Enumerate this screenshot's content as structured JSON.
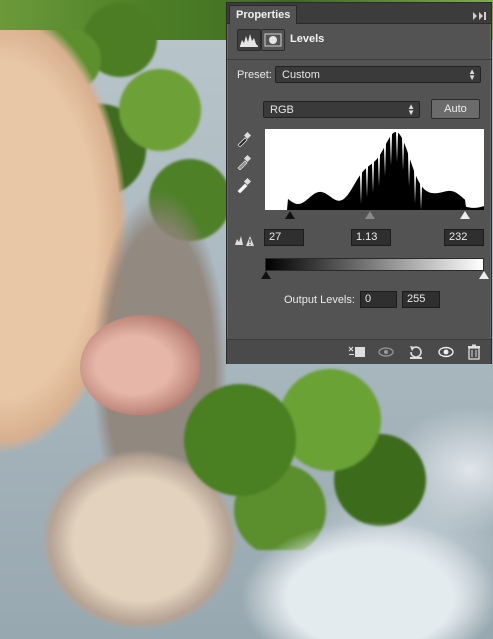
{
  "panel": {
    "tab_label": "Properties",
    "menu_glyph": "▸▸",
    "title": "Levels",
    "preset_label": "Preset:",
    "preset_value": "Custom",
    "channel_value": "RGB",
    "auto_label": "Auto",
    "input_black": "27",
    "input_gamma": "1.13",
    "input_white": "232",
    "output_levels_label": "Output Levels:",
    "output_black": "0",
    "output_white": "255"
  },
  "icons": {
    "header": [
      "levels-adjustment-icon",
      "mask-icon"
    ],
    "droppers": [
      "black-point-eyedropper-icon",
      "gray-point-eyedropper-icon",
      "white-point-eyedropper-icon"
    ],
    "footer": [
      "clip-to-layer-icon",
      "view-previous-state-icon",
      "reset-icon",
      "visibility-eye-icon",
      "trash-icon"
    ]
  },
  "colors": {
    "panel_bg": "#535353",
    "field_bg": "#2f2f2f",
    "histogram_bg": "#ffffff",
    "histogram_fill": "#000000"
  }
}
